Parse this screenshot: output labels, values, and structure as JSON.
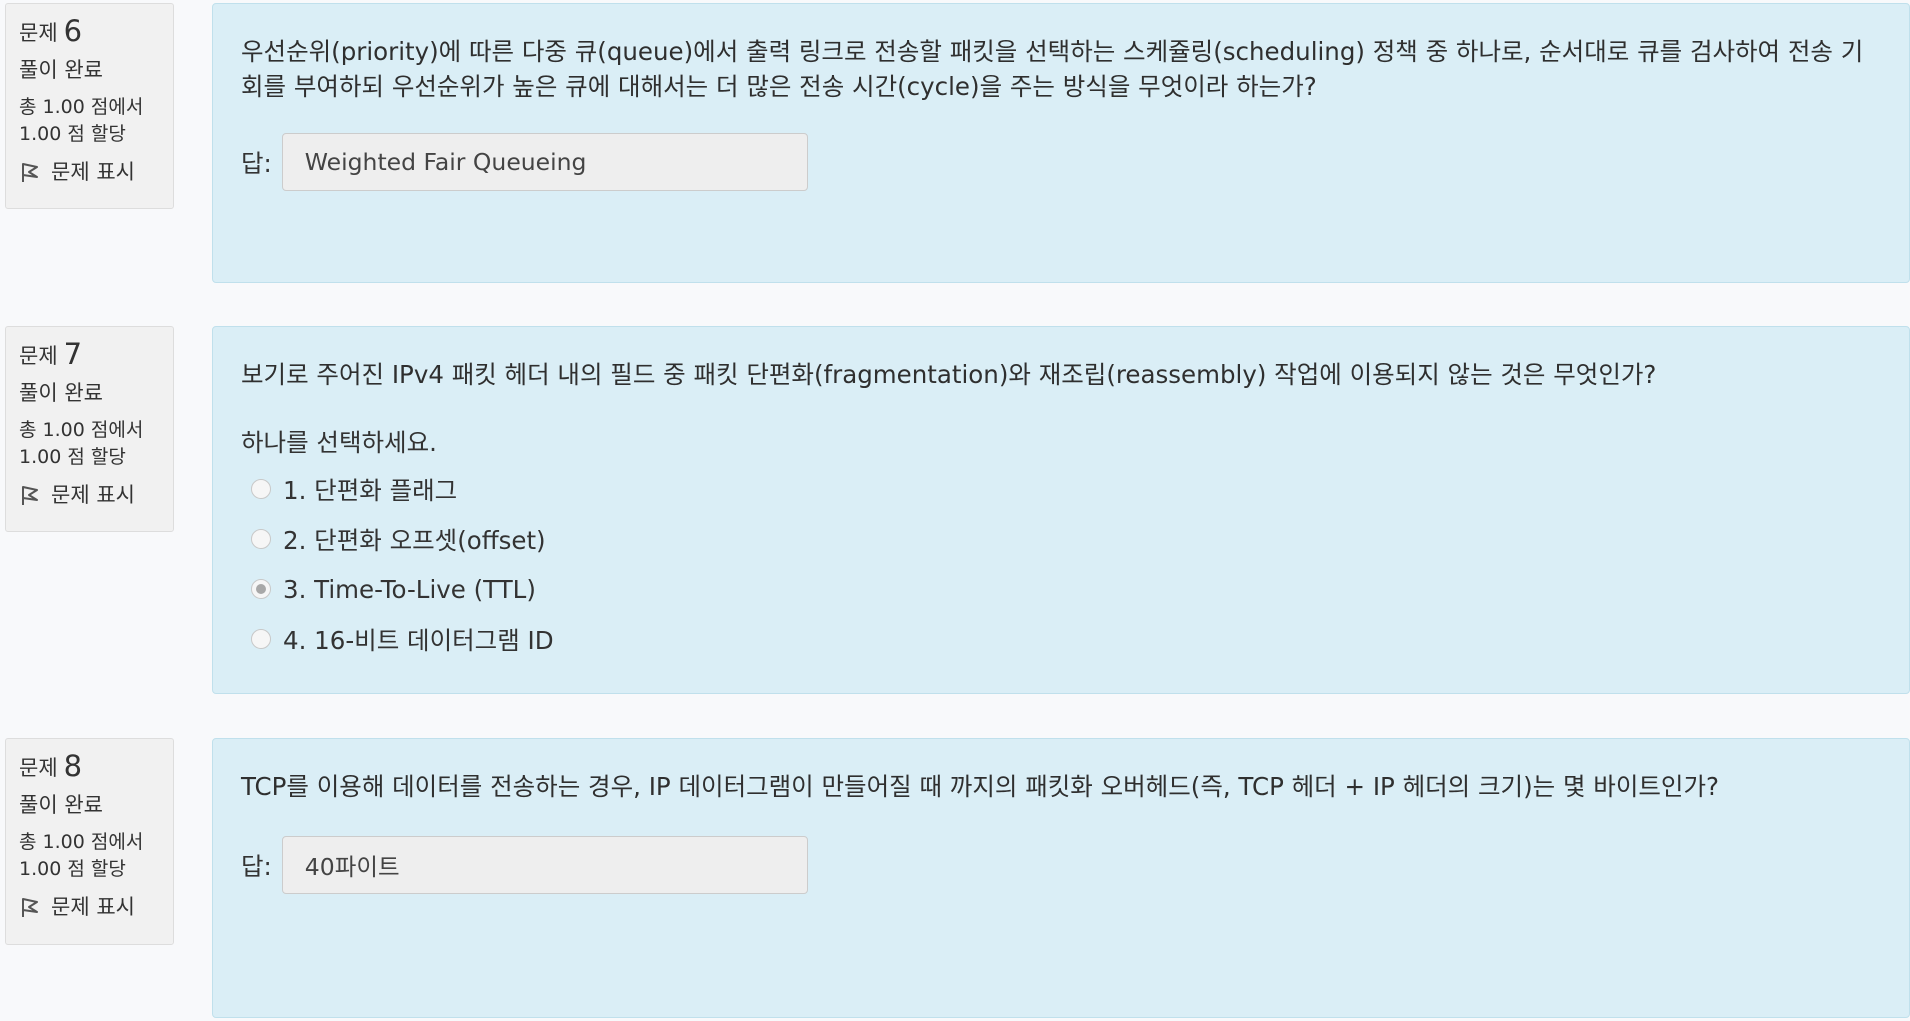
{
  "questions": [
    {
      "label": "문제",
      "number": "6",
      "state": "풀이 완료",
      "grade_line1": "총 1.00 점에서",
      "grade_line2": "1.00 점 할당",
      "flag_label": "문제 표시",
      "text": "우선순위(priority)에 따른 다중 큐(queue)에서 출력 링크로 전송할 패킷을 선택하는 스케쥴링(scheduling) 정책 중 하나로, 순서대로 큐를 검사하여 전송 기회를 부여하되 우선순위가 높은 큐에 대해서는 더 많은 전송 시간(cycle)을 주는 방식을 무엇이라 하는가?",
      "answer_label": "답:",
      "answer_value": "Weighted Fair Queueing"
    },
    {
      "label": "문제",
      "number": "7",
      "state": "풀이 완료",
      "grade_line1": "총 1.00 점에서",
      "grade_line2": "1.00 점 할당",
      "flag_label": "문제 표시",
      "text": "보기로 주어진 IPv4 패킷 헤더 내의 필드 중 패킷 단편화(fragmentation)와 재조립(reassembly) 작업에 이용되지 않는 것은 무엇인가?",
      "prompt": "하나를 선택하세요.",
      "options": [
        {
          "label": "1. 단편화 플래그",
          "checked": false
        },
        {
          "label": "2. 단편화 오프셋(offset)",
          "checked": false
        },
        {
          "label": "3. Time-To-Live (TTL)",
          "checked": true
        },
        {
          "label": "4. 16-비트 데이터그램 ID",
          "checked": false
        }
      ]
    },
    {
      "label": "문제",
      "number": "8",
      "state": "풀이 완료",
      "grade_line1": "총 1.00 점에서",
      "grade_line2": "1.00 점 할당",
      "flag_label": "문제 표시",
      "text": "TCP를 이용해 데이터를 전송하는 경우, IP 데이터그램이 만들어질 때 까지의 패킷화 오버헤드(즉, TCP 헤더 + IP 헤더의 크기)는 몇 바이트인가?",
      "answer_label": "답:",
      "answer_value": "40파이트"
    }
  ],
  "colors": {
    "content_background": "#daeef6",
    "info_background": "#f1f1f1",
    "page_background": "#f8f9fb"
  }
}
